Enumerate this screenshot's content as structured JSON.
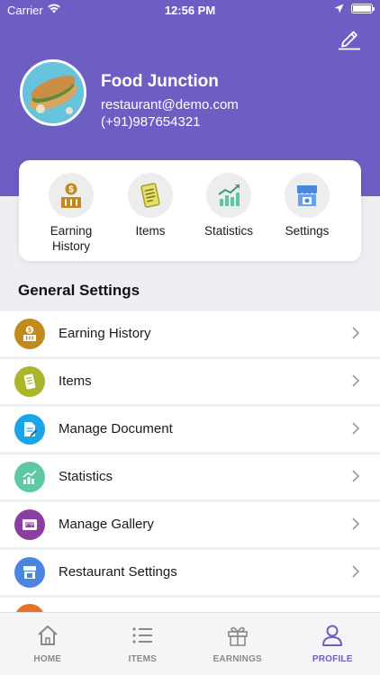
{
  "status_bar": {
    "carrier": "Carrier",
    "time": "12:56 PM"
  },
  "profile": {
    "name": "Food Junction",
    "email": "restaurant@demo.com",
    "phone": "(+91)987654321"
  },
  "quick_actions": [
    {
      "label": "Earning History",
      "icon": "earning-icon"
    },
    {
      "label": "Items",
      "icon": "items-icon"
    },
    {
      "label": "Statistics",
      "icon": "statistics-icon"
    },
    {
      "label": "Settings",
      "icon": "store-icon"
    }
  ],
  "general_settings": {
    "title": "General Settings",
    "items": [
      {
        "label": "Earning History",
        "icon": "earning-icon",
        "color": "#c08a1c"
      },
      {
        "label": "Items",
        "icon": "items-icon",
        "color": "#a9b52a"
      },
      {
        "label": "Manage Document",
        "icon": "document-icon",
        "color": "#1aa6e6"
      },
      {
        "label": "Statistics",
        "icon": "statistics-icon",
        "color": "#5cc8a4"
      },
      {
        "label": "Manage Gallery",
        "icon": "gallery-icon",
        "color": "#8a3fa0"
      },
      {
        "label": "Restaurant Settings",
        "icon": "store-icon",
        "color": "#4a86e0"
      }
    ]
  },
  "tabbar": [
    {
      "label": "HOME",
      "icon": "home-icon",
      "active": false
    },
    {
      "label": "ITEMS",
      "icon": "list-icon",
      "active": false
    },
    {
      "label": "EARNINGS",
      "icon": "gift-icon",
      "active": false
    },
    {
      "label": "PROFILE",
      "icon": "person-icon",
      "active": true
    }
  ],
  "colors": {
    "brand": "#6d5ec4",
    "inactive_tab": "#8a8a8a"
  }
}
